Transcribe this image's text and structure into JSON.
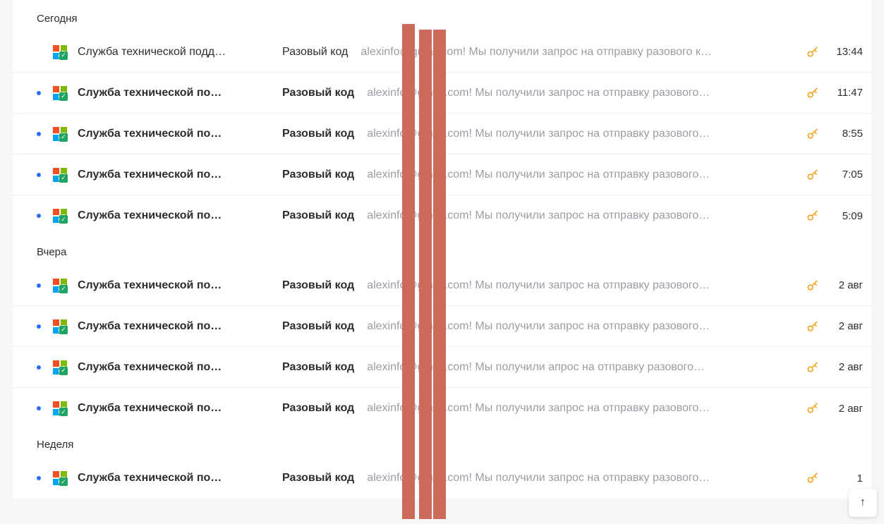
{
  "groups": [
    {
      "label": "Сегодня",
      "rows": [
        {
          "unread": false,
          "sender": "Служба технической подд…",
          "subject": "Разовый код",
          "preview": "alexinfo@gmail.com! Мы получили запрос на отправку разового к…",
          "date": "13:44"
        },
        {
          "unread": true,
          "sender": "Служба технической по…",
          "subject": "Разовый код",
          "preview": "alexinfo@gmail.com! Мы получили запрос на отправку разового…",
          "date": "11:47"
        },
        {
          "unread": true,
          "sender": "Служба технической по…",
          "subject": "Разовый код",
          "preview": "alexinfo@gmail.com! Мы получили запрос на отправку разового…",
          "date": "8:55"
        },
        {
          "unread": true,
          "sender": "Служба технической по…",
          "subject": "Разовый код",
          "preview": "alexinfo@gmail.com! Мы получили запрос на отправку разового…",
          "date": "7:05"
        },
        {
          "unread": true,
          "sender": "Служба технической по…",
          "subject": "Разовый код",
          "preview": "alexinfo@gmail.com! Мы получили запрос на отправку разового…",
          "date": "5:09"
        }
      ]
    },
    {
      "label": "Вчера",
      "rows": [
        {
          "unread": true,
          "sender": "Служба технической по…",
          "subject": "Разовый код",
          "preview": "alexinfo@gmail.com! Мы получили запрос на отправку разового…",
          "date": "2 авг"
        },
        {
          "unread": true,
          "sender": "Служба технической по…",
          "subject": "Разовый код",
          "preview": "alexinfo@gmail.com! Мы получили запрос на отправку разового…",
          "date": "2 авг"
        },
        {
          "unread": true,
          "sender": "Служба технической по…",
          "subject": "Разовый код",
          "preview": "alexinfo@gmail.com! Мы получили апрос на отправку разового…",
          "date": "2 авг"
        },
        {
          "unread": true,
          "sender": "Служба технической по…",
          "subject": "Разовый код",
          "preview": "alexinfo@gmail.com! Мы получили запрос на отправку разового…",
          "date": "2 авг"
        }
      ]
    },
    {
      "label": "Неделя",
      "rows": [
        {
          "unread": true,
          "sender": "Служба технической по…",
          "subject": "Разовый код",
          "preview": "alexinfo@gmail.com! Мы получили запрос на отправку разового…",
          "date": "1"
        }
      ]
    }
  ],
  "icons": {
    "sender_icon": "microsoft-logo",
    "shield_check": "✓",
    "key": "key-icon",
    "scroll_top": "↑"
  }
}
